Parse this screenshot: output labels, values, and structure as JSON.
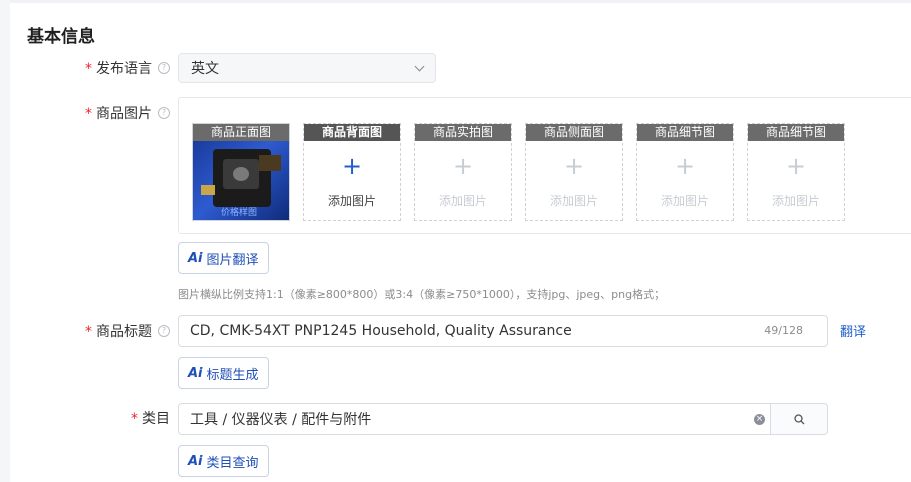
{
  "section": {
    "title": "基本信息"
  },
  "language": {
    "label": "发布语言",
    "value": "英文"
  },
  "images": {
    "label": "商品图片",
    "slots": [
      {
        "caption": "商品正面图",
        "watermark": "价格样图"
      },
      {
        "caption": "商品背面图",
        "add_text": "添加图片"
      },
      {
        "caption": "商品实拍图",
        "add_text": "添加图片"
      },
      {
        "caption": "商品侧面图",
        "add_text": "添加图片"
      },
      {
        "caption": "商品细节图",
        "add_text": "添加图片"
      },
      {
        "caption": "商品细节图",
        "add_text": "添加图片"
      }
    ],
    "ai_button": "图片翻译",
    "hint": "图片横纵比例支持1:1（像素≥800*800）或3:4（像素≥750*1000），支持jpg、jpeg、png格式；"
  },
  "title_field": {
    "label": "商品标题",
    "value": "CD, CMK-54XT PNP1245 Household, Quality Assurance",
    "count": "49/128",
    "translate": "翻译",
    "ai_button": "标题生成"
  },
  "category": {
    "label": "类目",
    "value": "工具 / 仪器仪表 / 配件与附件",
    "ai_button": "类目查询"
  },
  "common": {
    "required_mark": "*",
    "ai_icon": "Ai",
    "plus": "+"
  },
  "colors": {
    "accent": "#1f5fcc",
    "required": "#f5222d",
    "caption_bg": "#6b6b6b"
  }
}
